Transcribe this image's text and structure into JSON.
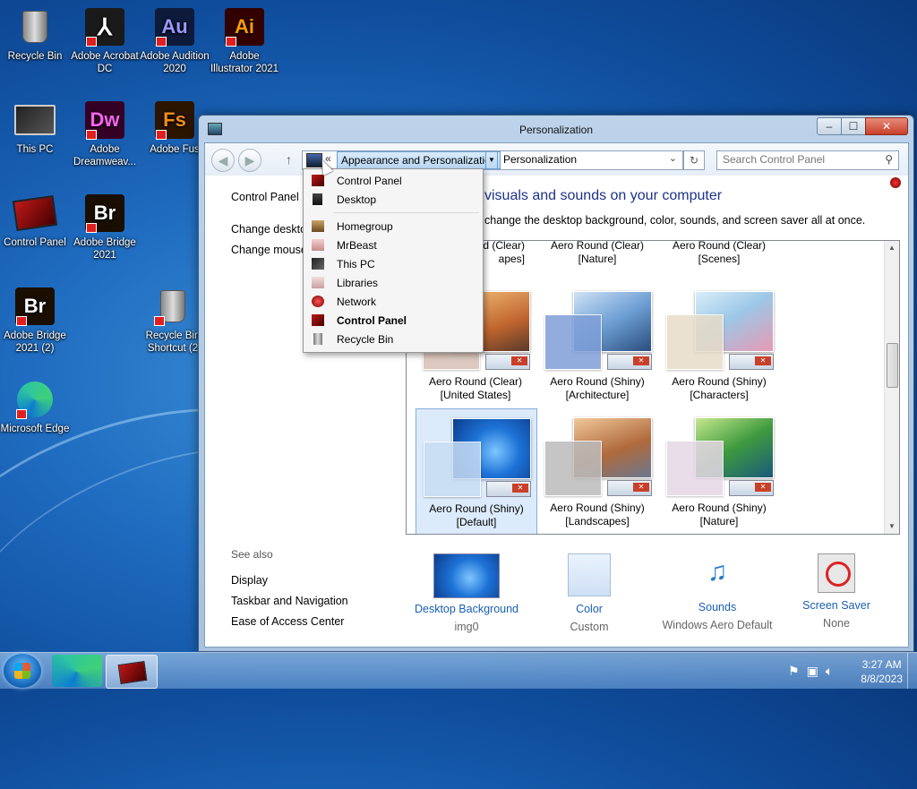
{
  "desktop": {
    "icons": [
      {
        "label": "Recycle Bin"
      },
      {
        "label": "Adobe Acrobat DC"
      },
      {
        "label": "Adobe Audition 2020",
        "glyph": "Au",
        "color": "#0d1a3a",
        "fg": "#9999ff"
      },
      {
        "label": "Adobe Illustrator 2021",
        "glyph": "Ai",
        "color": "#330000",
        "fg": "#ff9a00"
      },
      {
        "label": "This PC"
      },
      {
        "label": "Adobe Dreamweav...",
        "glyph": "Dw",
        "color": "#350025",
        "fg": "#ff61f6"
      },
      {
        "label": "Adobe Fus",
        "glyph": "Fs",
        "color": "#2b1400",
        "fg": "#f08c1c"
      },
      {
        "label": "Control Panel"
      },
      {
        "label": "Adobe Bridge 2021",
        "glyph": "Br",
        "color": "#1a0e00",
        "fg": "#ffffff"
      },
      {
        "label": "Adobe Bridge 2021 (2)",
        "glyph": "Br",
        "color": "#1a0e00",
        "fg": "#ffffff"
      },
      {
        "label": "Recycle Bin Shortcut (2"
      },
      {
        "label": "Microsoft Edge"
      }
    ]
  },
  "window": {
    "title": "Personalization",
    "controls": {
      "min": "–",
      "max": "☐",
      "close": "✕"
    },
    "address": {
      "crumb_active": "Appearance and Personalization",
      "crumb_current": "Personalization",
      "chevron": "«"
    },
    "search_placeholder": "Search Control Panel",
    "left_pane": {
      "home": "Control Panel H",
      "links": [
        "Change deskto",
        "Change mouse"
      ],
      "see_also_title": "See also",
      "see_also": [
        "Display",
        "Taskbar and Navigation",
        "Ease of Access Center"
      ]
    },
    "heading": "visuals and sounds on your computer",
    "subtext": "change the desktop background, color, sounds, and screen saver all at once.",
    "themes_partial_row": [
      {
        "line1": "d (Clear)",
        "line2": "apes]"
      },
      {
        "line1": "Aero Round (Clear)",
        "line2": "[Nature]"
      },
      {
        "line1": "Aero Round (Clear)",
        "line2": "[Scenes]"
      }
    ],
    "themes": [
      {
        "line1": "Aero Round (Clear)",
        "line2": "[United States]",
        "bg": "#c48a5a",
        "color": "#d8c0b4",
        "selected": false
      },
      {
        "line1": "Aero Round (Shiny)",
        "line2": "[Architecture]",
        "bg": "#7ea6d6",
        "color": "#7f9fd8",
        "selected": false
      },
      {
        "line1": "Aero Round (Shiny)",
        "line2": "[Characters]",
        "bg": "#c9a7b5",
        "color": "#e7dcc8",
        "selected": false
      },
      {
        "line1": "Aero Round (Shiny)",
        "line2": "[Default]",
        "bg": "#1d72d6",
        "color": "#c7dcf3",
        "selected": true
      },
      {
        "line1": "Aero Round (Shiny)",
        "line2": "[Landscapes]",
        "bg": "#b06a3c",
        "color": "#bcbcbc",
        "selected": false
      },
      {
        "line1": "Aero Round (Shiny)",
        "line2": "[Nature]",
        "bg": "#3e9a3e",
        "color": "#e5d8e6",
        "selected": false
      }
    ],
    "bottom": [
      {
        "name": "Desktop Background",
        "sub": "img0"
      },
      {
        "name": "Color",
        "sub": "Custom"
      },
      {
        "name": "Sounds",
        "sub": "Windows Aero Default"
      },
      {
        "name": "Screen Saver",
        "sub": "None"
      }
    ]
  },
  "dropdown": {
    "items": [
      {
        "label": "Control Panel",
        "bold": false,
        "icon": "control-panel-icon"
      },
      {
        "label": "Desktop",
        "bold": false,
        "icon": "desktop-icon"
      },
      {
        "label": "Homegroup",
        "bold": false,
        "icon": "homegroup-icon"
      },
      {
        "label": "MrBeast",
        "bold": false,
        "icon": "user-folder-icon"
      },
      {
        "label": "This PC",
        "bold": false,
        "icon": "computer-icon"
      },
      {
        "label": "Libraries",
        "bold": false,
        "icon": "libraries-icon"
      },
      {
        "label": "Network",
        "bold": false,
        "icon": "network-icon"
      },
      {
        "label": "Control Panel",
        "bold": true,
        "icon": "control-panel-icon"
      },
      {
        "label": "Recycle Bin",
        "bold": false,
        "icon": "recycle-bin-icon"
      }
    ]
  },
  "taskbar": {
    "time": "3:27 AM",
    "date": "8/8/2023",
    "tray_icons": [
      "flag-icon",
      "network-icon",
      "volume-icon"
    ]
  }
}
